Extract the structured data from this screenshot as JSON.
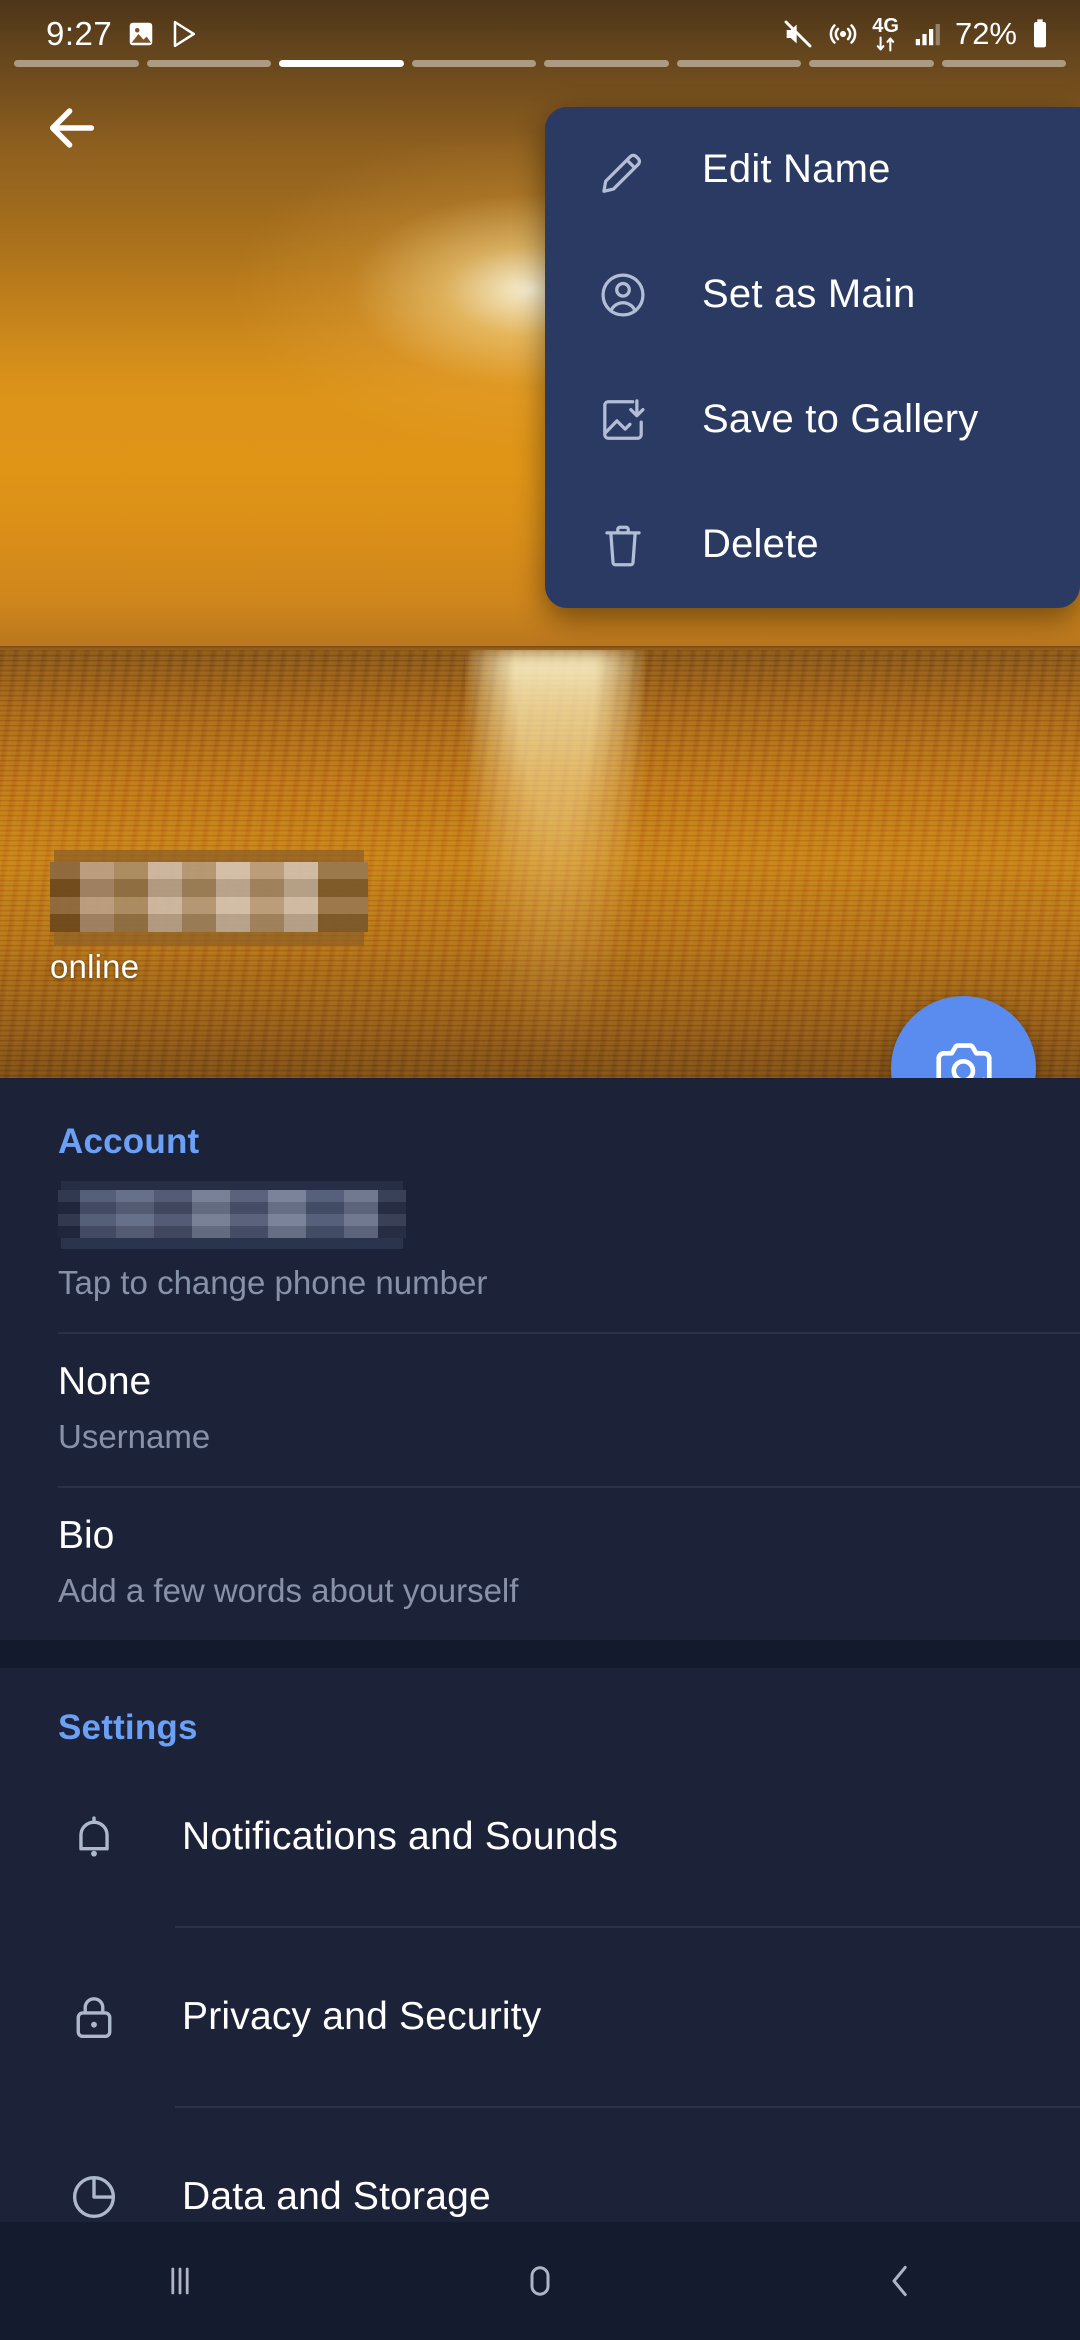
{
  "statusbar": {
    "time": "9:27",
    "battery_percent": "72%",
    "icons": [
      "photo-icon",
      "play-store-icon",
      "mute-icon",
      "hotspot-icon",
      "network-4g-icon",
      "signal-bars-icon",
      "battery-icon"
    ],
    "network_label": "4G"
  },
  "photo_pager": {
    "total": 8,
    "active_index": 2
  },
  "header": {
    "back_label": "Back"
  },
  "popup_menu": {
    "items": [
      {
        "label": "Edit Name",
        "icon": "pencil-icon"
      },
      {
        "label": "Set as Main",
        "icon": "user-circle-icon"
      },
      {
        "label": "Save to Gallery",
        "icon": "image-download-icon"
      },
      {
        "label": "Delete",
        "icon": "trash-icon"
      }
    ]
  },
  "profile": {
    "name_redacted": true,
    "status": "online",
    "fab_icon": "camera-plus-icon"
  },
  "account": {
    "title": "Account",
    "rows": [
      {
        "value_redacted": true,
        "value": "",
        "sub": "Tap to change phone number"
      },
      {
        "value": "None",
        "sub": "Username"
      },
      {
        "value": "Bio",
        "sub": "Add a few words about yourself"
      }
    ]
  },
  "settings": {
    "title": "Settings",
    "rows": [
      {
        "label": "Notifications and Sounds",
        "icon": "bell-icon"
      },
      {
        "label": "Privacy and Security",
        "icon": "lock-icon"
      },
      {
        "label": "Data and Storage",
        "icon": "pie-chart-icon"
      }
    ]
  },
  "navbar": {
    "items": [
      {
        "label": "Recents",
        "icon": "recents-icon"
      },
      {
        "label": "Home",
        "icon": "home-icon"
      },
      {
        "label": "Back",
        "icon": "back-chevron-icon"
      }
    ]
  },
  "colors": {
    "accent_blue": "#6aa0f5",
    "fab_blue": "#5a8cf0",
    "panel_bg": "#1c2339",
    "menu_bg": "#2a3a63",
    "page_bg": "#141a2e",
    "muted_text": "#8791a8"
  }
}
